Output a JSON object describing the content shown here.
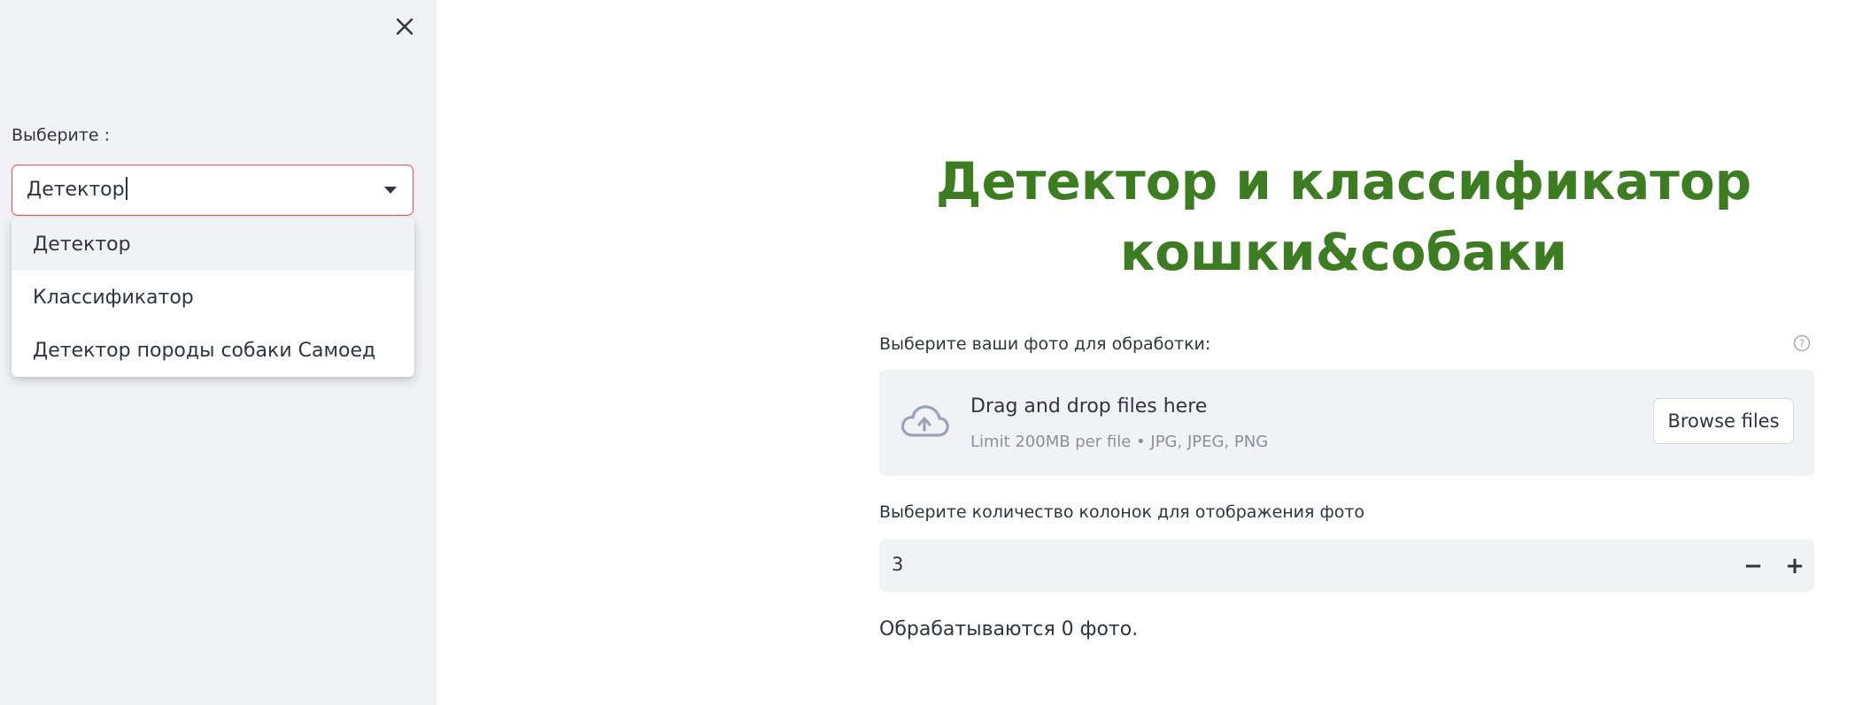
{
  "sidebar": {
    "select_label": "Выберите :",
    "select_value": "Детектор",
    "options": [
      {
        "label": "Детектор"
      },
      {
        "label": "Классификатор"
      },
      {
        "label": "Детектор породы собаки Самоед"
      }
    ],
    "close_icon": "close-icon"
  },
  "main": {
    "title_line1": "Детектор и классификатор",
    "title_line2": "кошки&собаки",
    "title_color": "#3c7d22",
    "uploader": {
      "label": "Выберите ваши фото для обработки:",
      "drop_text": "Drag and drop files here",
      "limit_text": "Limit 200MB per file • JPG, JPEG, PNG",
      "browse_label": "Browse files",
      "icon": "cloud-upload-icon"
    },
    "columns": {
      "label": "Выберите количество колонок для отображения фото",
      "value": "3",
      "minus_label": "−",
      "plus_label": "+"
    },
    "status": "Обрабатываются 0 фото."
  },
  "colors": {
    "accent": "#ff4b4b",
    "sidebar_bg": "#f0f2f6",
    "text": "#31333f"
  }
}
